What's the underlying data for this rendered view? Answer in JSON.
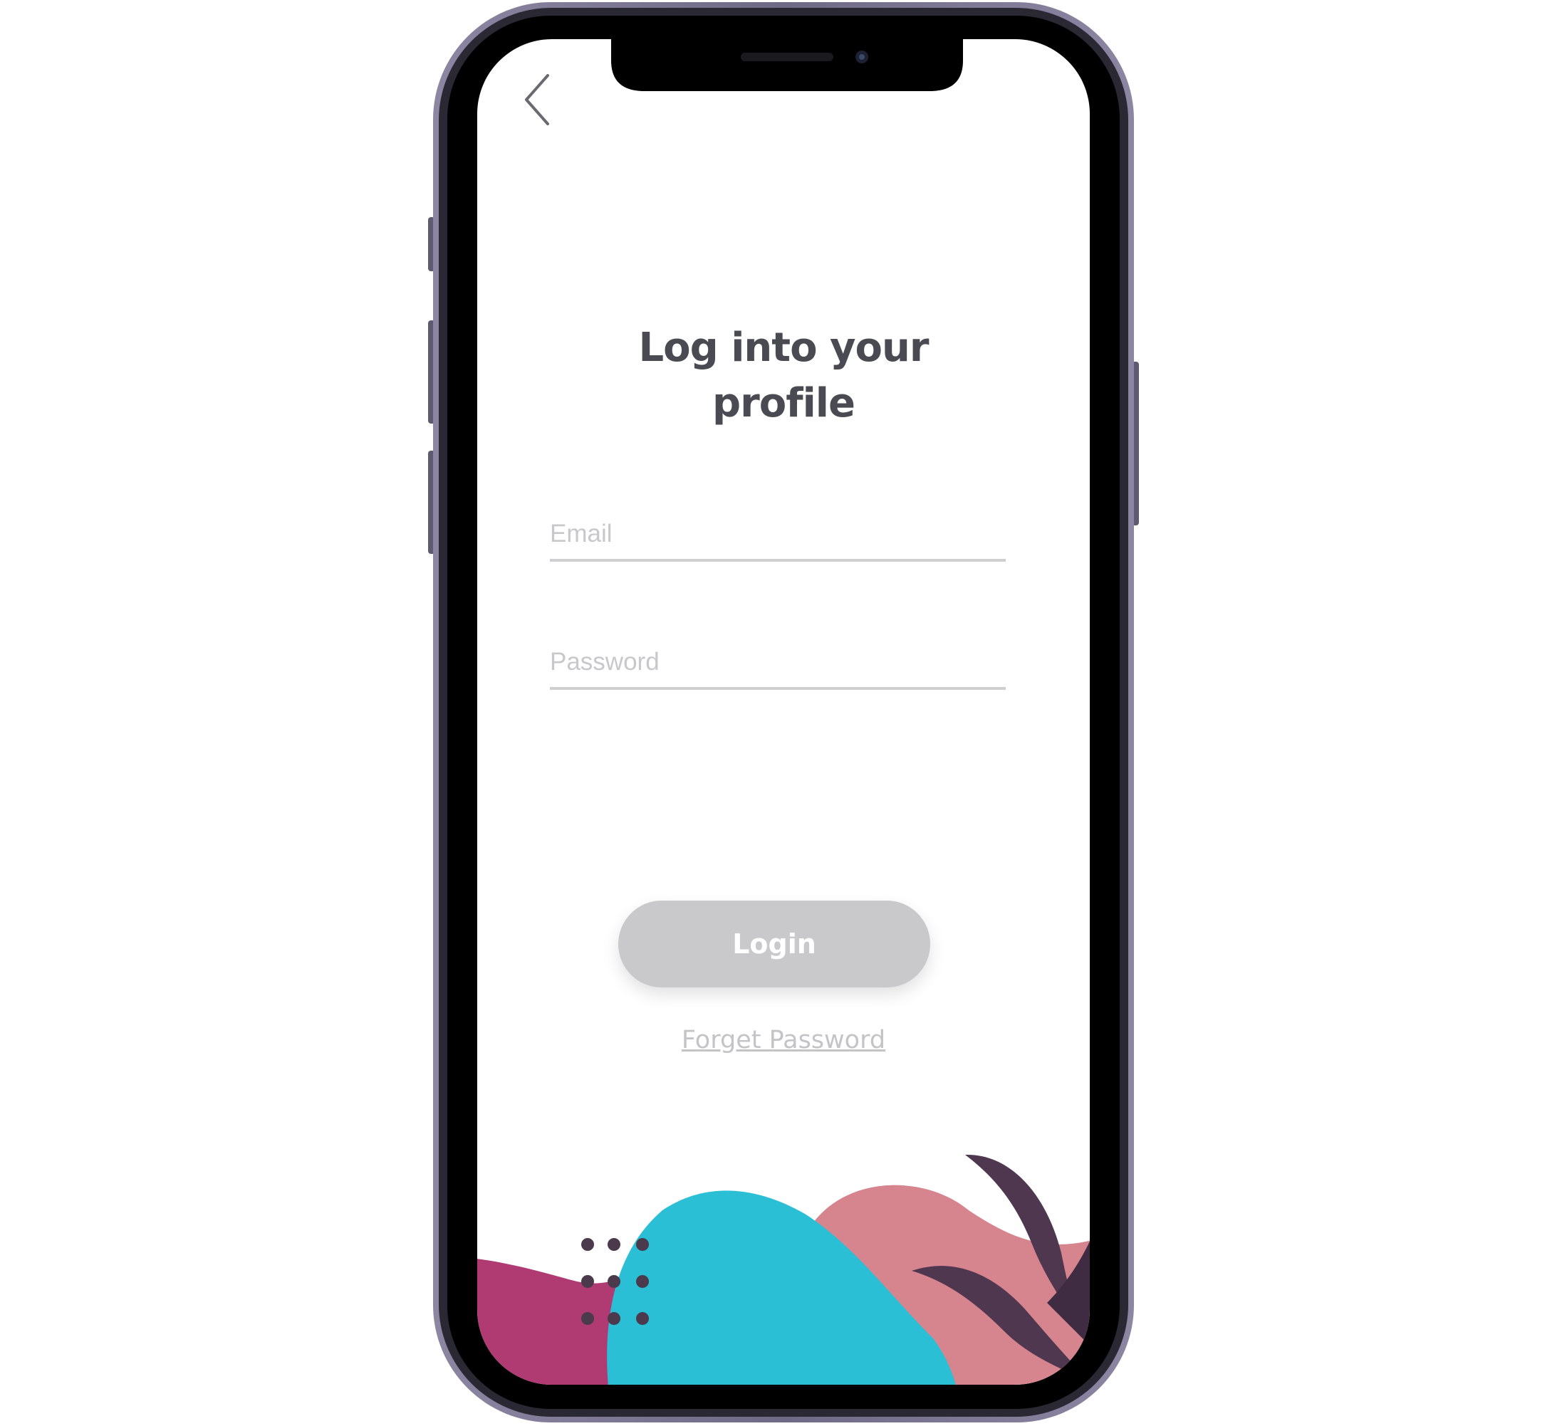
{
  "header": {
    "back_icon": "chevron-left-icon"
  },
  "login_screen": {
    "title_line1": "Log into your",
    "title_line2": "profile",
    "email_placeholder": "Email",
    "password_placeholder": "Password",
    "login_label": "Login",
    "forgot_label": "Forget Password"
  },
  "colors": {
    "title": "#4a4a52",
    "button_bg": "#c9c9cc",
    "teal_shape": "#2bbfd6",
    "pink_shape": "#d6848d",
    "magenta_shape": "#b03a72",
    "leaf": "#4e374f"
  }
}
